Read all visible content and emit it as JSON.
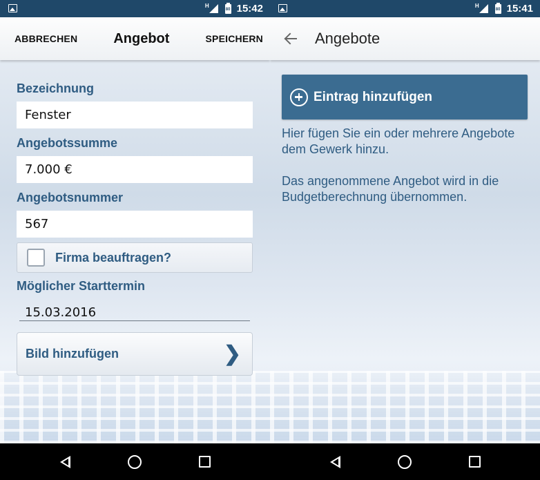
{
  "left_screen": {
    "status": {
      "time": "15:42",
      "network": "H",
      "battery": "80"
    },
    "appbar": {
      "cancel_label": "ABBRECHEN",
      "title": "Angebot",
      "save_label": "SPEICHERN"
    },
    "form": {
      "name_label": "Bezeichnung",
      "name_value": "Fenster",
      "amount_label": "Angebotssumme",
      "amount_value": "7.000 €",
      "number_label": "Angebotsnummer",
      "number_value": "567",
      "commission_label": "Firma beauftragen?",
      "commission_checked": false,
      "start_label": "Möglicher Starttermin",
      "start_value": "15.03.2016",
      "add_image_label": "Bild hinzufügen",
      "add_image_chevron": "❯"
    }
  },
  "right_screen": {
    "status": {
      "time": "15:41",
      "network": "H",
      "battery": "80"
    },
    "appbar": {
      "title": "Angebote"
    },
    "add_entry_label": "Eintrag hinzufügen",
    "info_1": "Hier fügen Sie ein oder mehrere Angebote dem Gewerk hinzu.",
    "info_2": "Das angenommene Angebot wird in die Budgetberechnung übernommen."
  },
  "icons": {
    "status_gallery": "gallery-icon",
    "signal": "signal-icon",
    "battery": "battery-icon",
    "back_arrow": "back-arrow-icon",
    "plus_circle": "add-circle-icon",
    "nav_back": "nav-back-icon",
    "nav_home": "nav-home-icon",
    "nav_recent": "nav-recent-icon"
  },
  "colors": {
    "status_bar": "#1f4869",
    "accent_text": "#2f5c82",
    "add_button": "#3b6c91"
  }
}
